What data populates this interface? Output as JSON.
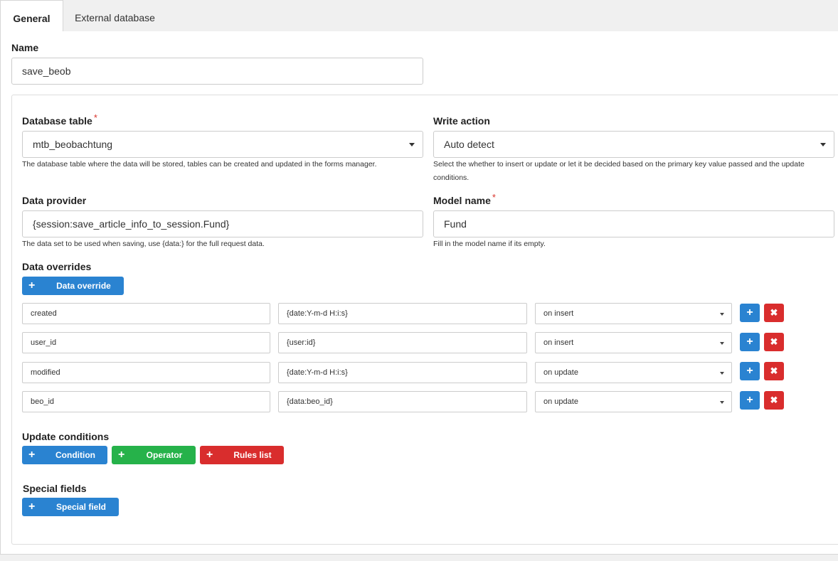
{
  "tabs": [
    {
      "label": "General"
    },
    {
      "label": "External database"
    }
  ],
  "name": {
    "label": "Name",
    "value": "save_beob"
  },
  "database_table": {
    "label": "Database table",
    "required": "*",
    "value": "mtb_beobachtung",
    "help": "The database table where the data will be stored, tables can be created and updated in the forms manager."
  },
  "write_action": {
    "label": "Write action",
    "value": "Auto detect",
    "help_line1": "Select the whether to insert or update or let it be decided based on the primary key value passed and the update",
    "help_line2": "conditions."
  },
  "data_provider": {
    "label": "Data provider",
    "value": "{session:save_article_info_to_session.Fund}",
    "help": "The data set to be used when saving, use {data:} for the full request data."
  },
  "model_name": {
    "label": "Model name",
    "required": "*",
    "value": "Fund",
    "help": "Fill in the model name if its empty."
  },
  "data_overrides": {
    "label": "Data overrides",
    "add_button": "Data override",
    "rows": [
      {
        "field": "created",
        "value": "{date:Y-m-d H:i:s}",
        "mode": "on insert"
      },
      {
        "field": "user_id",
        "value": "{user:id}",
        "mode": "on insert"
      },
      {
        "field": "modified",
        "value": "{date:Y-m-d H:i:s}",
        "mode": "on update"
      },
      {
        "field": "beo_id",
        "value": "{data:beo_id}",
        "mode": "on update"
      }
    ]
  },
  "update_conditions": {
    "label": "Update conditions",
    "condition_button": "Condition",
    "operator_button": "Operator",
    "rules_button": "Rules list"
  },
  "special_fields": {
    "label": "Special fields",
    "add_button": "Special field"
  },
  "colors": {
    "blue": "#2a83d1",
    "green": "#26b24a",
    "red": "#d92d2d",
    "required": "#d9342b"
  },
  "icons": {
    "add": "plus-icon",
    "remove": "times-icon",
    "dropdown": "caret-down-icon"
  }
}
